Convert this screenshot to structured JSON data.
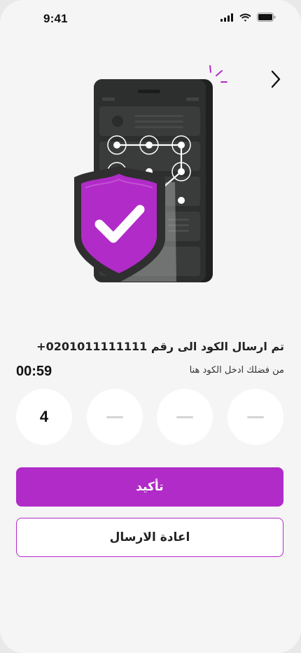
{
  "status_bar": {
    "time": "9:41",
    "signal_icon": "cellular-signal-icon",
    "wifi_icon": "wifi-icon",
    "battery_icon": "battery-icon"
  },
  "header": {
    "back_icon": "chevron-right-icon"
  },
  "illustration": {
    "name": "phone-with-shield-check-illustration"
  },
  "verification": {
    "sent_message": "تم ارسال الكود الى رقم 0201011111111+",
    "instruction": "من فضلك ادخل الكود هنا",
    "timer": "00:59"
  },
  "otp": {
    "digits": [
      "4",
      "",
      "",
      ""
    ]
  },
  "buttons": {
    "confirm_label": "تأكيد",
    "resend_label": "اعادة الارسال"
  },
  "colors": {
    "accent": "#b12bc8",
    "background": "#f5f5f5",
    "phone_body": "#2b2c2c",
    "shield_dark": "#2f2f30"
  }
}
